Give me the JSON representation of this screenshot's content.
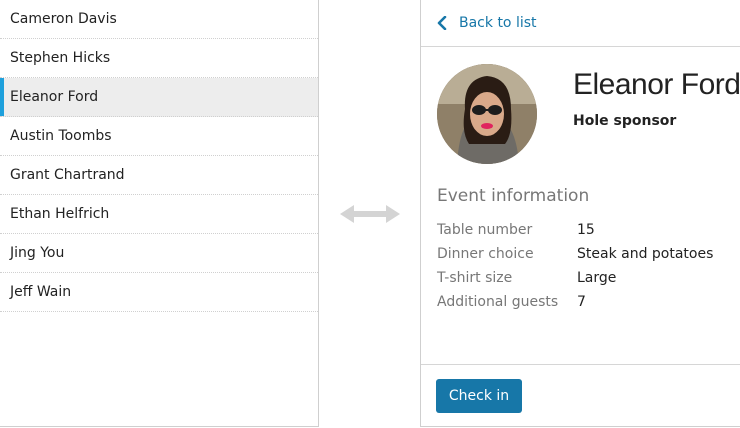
{
  "list": {
    "items": [
      {
        "name": "Cameron Davis"
      },
      {
        "name": "Stephen Hicks"
      },
      {
        "name": "Eleanor Ford"
      },
      {
        "name": "Austin Toombs"
      },
      {
        "name": "Grant Chartrand"
      },
      {
        "name": "Ethan Helfrich"
      },
      {
        "name": "Jing You"
      },
      {
        "name": "Jeff Wain"
      }
    ],
    "selected_index": 2
  },
  "detail": {
    "back_label": "Back to list",
    "name": "Eleanor Ford",
    "role": "Hole sponsor",
    "section_title": "Event information",
    "fields": [
      {
        "label": "Table number",
        "value": "15"
      },
      {
        "label": "Dinner choice",
        "value": "Steak and potatoes"
      },
      {
        "label": "T-shirt size",
        "value": "Large"
      },
      {
        "label": "Additional guests",
        "value": "7"
      }
    ],
    "checkin_label": "Check in"
  },
  "colors": {
    "accent": "#1ea0dc",
    "button": "#1777a8",
    "link": "#1777a8",
    "selected_row_bg": "#ededed"
  },
  "icons": {
    "back": "chevron-left-icon",
    "swap": "double-arrow-icon"
  }
}
